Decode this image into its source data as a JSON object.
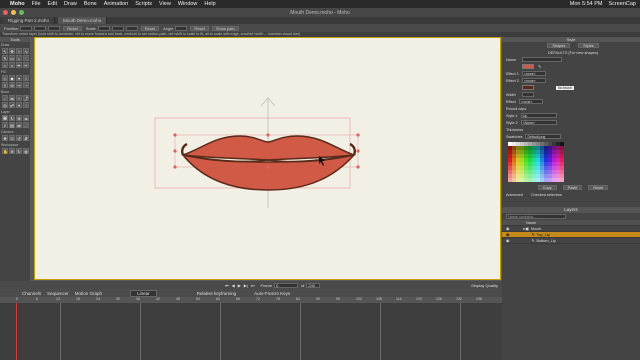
{
  "menubar": {
    "apple": "",
    "app": "Moho",
    "items": [
      "File",
      "Edit",
      "Draw",
      "Bone",
      "Animation",
      "Scripts",
      "View",
      "Window",
      "Help"
    ],
    "clock": "Mon 5:54 PM",
    "user": "ScreenCap"
  },
  "window": {
    "title": "Mouth Demo.moho - Moho",
    "tabs": [
      "Rigging Part 2.moho",
      "Mouth Demo.moho"
    ]
  },
  "toolopts": {
    "position_label": "Position",
    "reset": "Reset",
    "scale_label": "Scale",
    "angle_label": "Angle",
    "show_path": "Show path"
  },
  "hint": "Transform entire layer (hold shift to constrain, ctrl to move forward and back, cmd/ctrl to set motion path, ctrl+shift to scale to fit, alt to scale with edge, cmd/ctrl+shift+... maintain visual size)",
  "tools": {
    "header": "Tools",
    "sections": [
      "Draw",
      "Fill",
      "Bone",
      "Layer",
      "Camera",
      "Workspace"
    ]
  },
  "style": {
    "header": "Style",
    "tab_shapes": "Shapes",
    "tab_styles": "Styles",
    "defaults": "DEFAULTS (For new shapes)",
    "name_label": "Name",
    "effect1": "Effect 1",
    "effect2": "Effect 2",
    "width_label": "Width",
    "effect_label": "Effect",
    "none_opt": "<none>",
    "no_brush": "No brush",
    "round_caps": "Round caps",
    "style1": "Style 1",
    "style2": "Style 2",
    "thickness": "Thickness",
    "swatches": "Swatches",
    "swatches_val": "Default.png",
    "style1_val": "Lip",
    "style2_val": "<None>",
    "copy": "Copy",
    "paste": "Paste",
    "reset": "Reset",
    "advanced": "Advanced",
    "checked": "Checked selection",
    "fill_color": "#d05a45",
    "line_color": "#5a2a1a"
  },
  "layers": {
    "header": "Layers",
    "search": "Name contains...",
    "col_name": "Name",
    "rows": [
      {
        "name": "Mouth",
        "indent": 1
      },
      {
        "name": "Top_Lip",
        "indent": 2,
        "selected": true
      },
      {
        "name": "Bottom_Lip",
        "indent": 2
      }
    ]
  },
  "playbar": {
    "frame_label": "Frame",
    "frame_val": "0",
    "of": "of",
    "end": "240",
    "display_quality": "Display Quality"
  },
  "timeline": {
    "tabs": [
      "Channels",
      "Sequencer",
      "Motion Graph"
    ],
    "interp": "Linear",
    "relative_kf": "Relative keyframing",
    "auto_freeze": "Auto-Freeze Keys",
    "ruler_ticks": [
      "0",
      "6",
      "12",
      "18",
      "24",
      "30",
      "36",
      "42",
      "48",
      "54",
      "60",
      "66",
      "72",
      "78",
      "84",
      "90",
      "96",
      "102",
      "108",
      "114",
      "120",
      "126",
      "132",
      "138"
    ]
  },
  "colors": {
    "canvas": "#f2f0e4",
    "accent": "#c58a1a",
    "lip_fill": "#d05a45",
    "lip_line": "#5a2a1a"
  }
}
